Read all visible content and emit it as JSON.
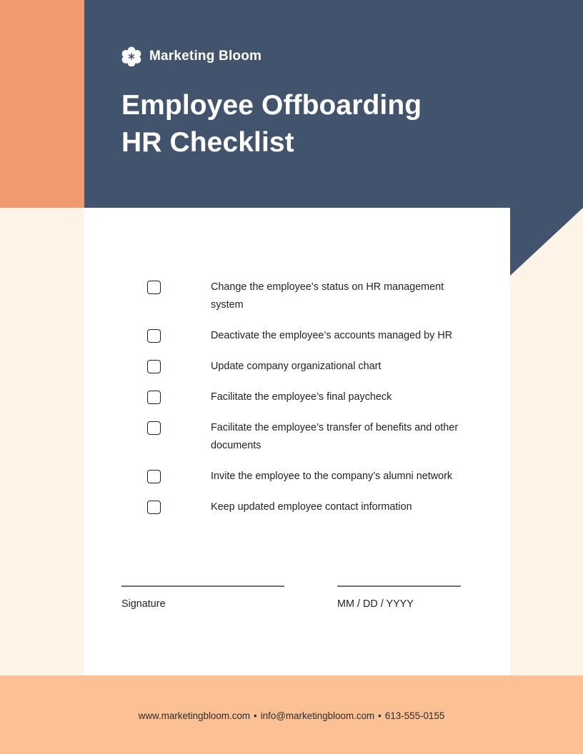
{
  "brand": {
    "name": "Marketing Bloom",
    "logo_icon": "flower-blossom-icon"
  },
  "header": {
    "title_line_1": "Employee Offboarding",
    "title_line_2": "HR Checklist"
  },
  "checklist": {
    "items": [
      {
        "label": "Change the employee’s status on HR management system",
        "checked": false
      },
      {
        "label": "Deactivate the employee’s accounts managed by HR",
        "checked": false
      },
      {
        "label": "Update company organizational chart",
        "checked": false
      },
      {
        "label": "Facilitate the employee’s final paycheck",
        "checked": false
      },
      {
        "label": "Facilitate the employee’s transfer of benefits and other documents",
        "checked": false
      },
      {
        "label": "Invite the employee to the company’s alumni network",
        "checked": false
      },
      {
        "label": "Keep updated employee contact information",
        "checked": false
      }
    ]
  },
  "signature_block": {
    "signature_caption": "Signature",
    "date_caption": "MM / DD / YYYY"
  },
  "footer": {
    "website": "www.marketingbloom.com",
    "separator_1": "•",
    "email": "info@marketingbloom.com",
    "separator_2": "•",
    "phone": "613-555-0155"
  },
  "colors": {
    "navy": "#42546D",
    "orange_panel": "#F09A6E",
    "orange_footer": "#FBC194",
    "cream": "#FDF3E7",
    "card_white": "#FFFFFF",
    "text_dark": "#231F20",
    "rule_gray": "#6E6E6E"
  }
}
